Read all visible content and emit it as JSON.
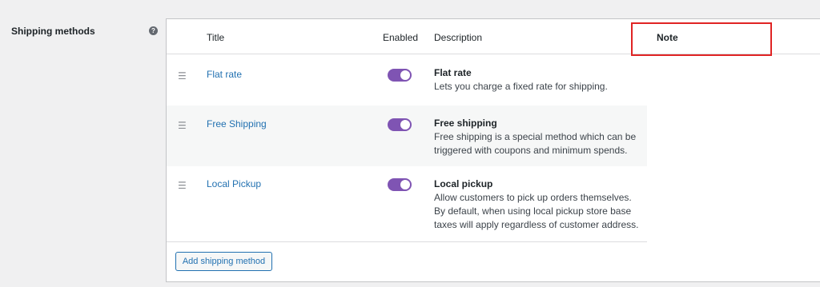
{
  "field_label": "Shipping methods",
  "help_icon": "question-circle-icon",
  "table": {
    "headers": {
      "title": "Title",
      "enabled": "Enabled",
      "description": "Description",
      "note": "Note"
    },
    "rows": [
      {
        "title": "Flat rate",
        "enabled": true,
        "desc_title": "Flat rate",
        "desc_text": "Lets you charge a fixed rate for shipping."
      },
      {
        "title": "Free Shipping",
        "enabled": true,
        "desc_title": "Free shipping",
        "desc_text": "Free shipping is a special method which can be triggered with coupons and minimum spends."
      },
      {
        "title": "Local Pickup",
        "enabled": true,
        "desc_title": "Local pickup",
        "desc_text": "Allow customers to pick up orders themselves. By default, when using local pickup store base taxes will apply regardless of customer address."
      }
    ]
  },
  "add_button_label": "Add shipping method",
  "colors": {
    "toggle_on": "#7f54b3",
    "link": "#2271b1",
    "highlight_border": "#e02424"
  }
}
